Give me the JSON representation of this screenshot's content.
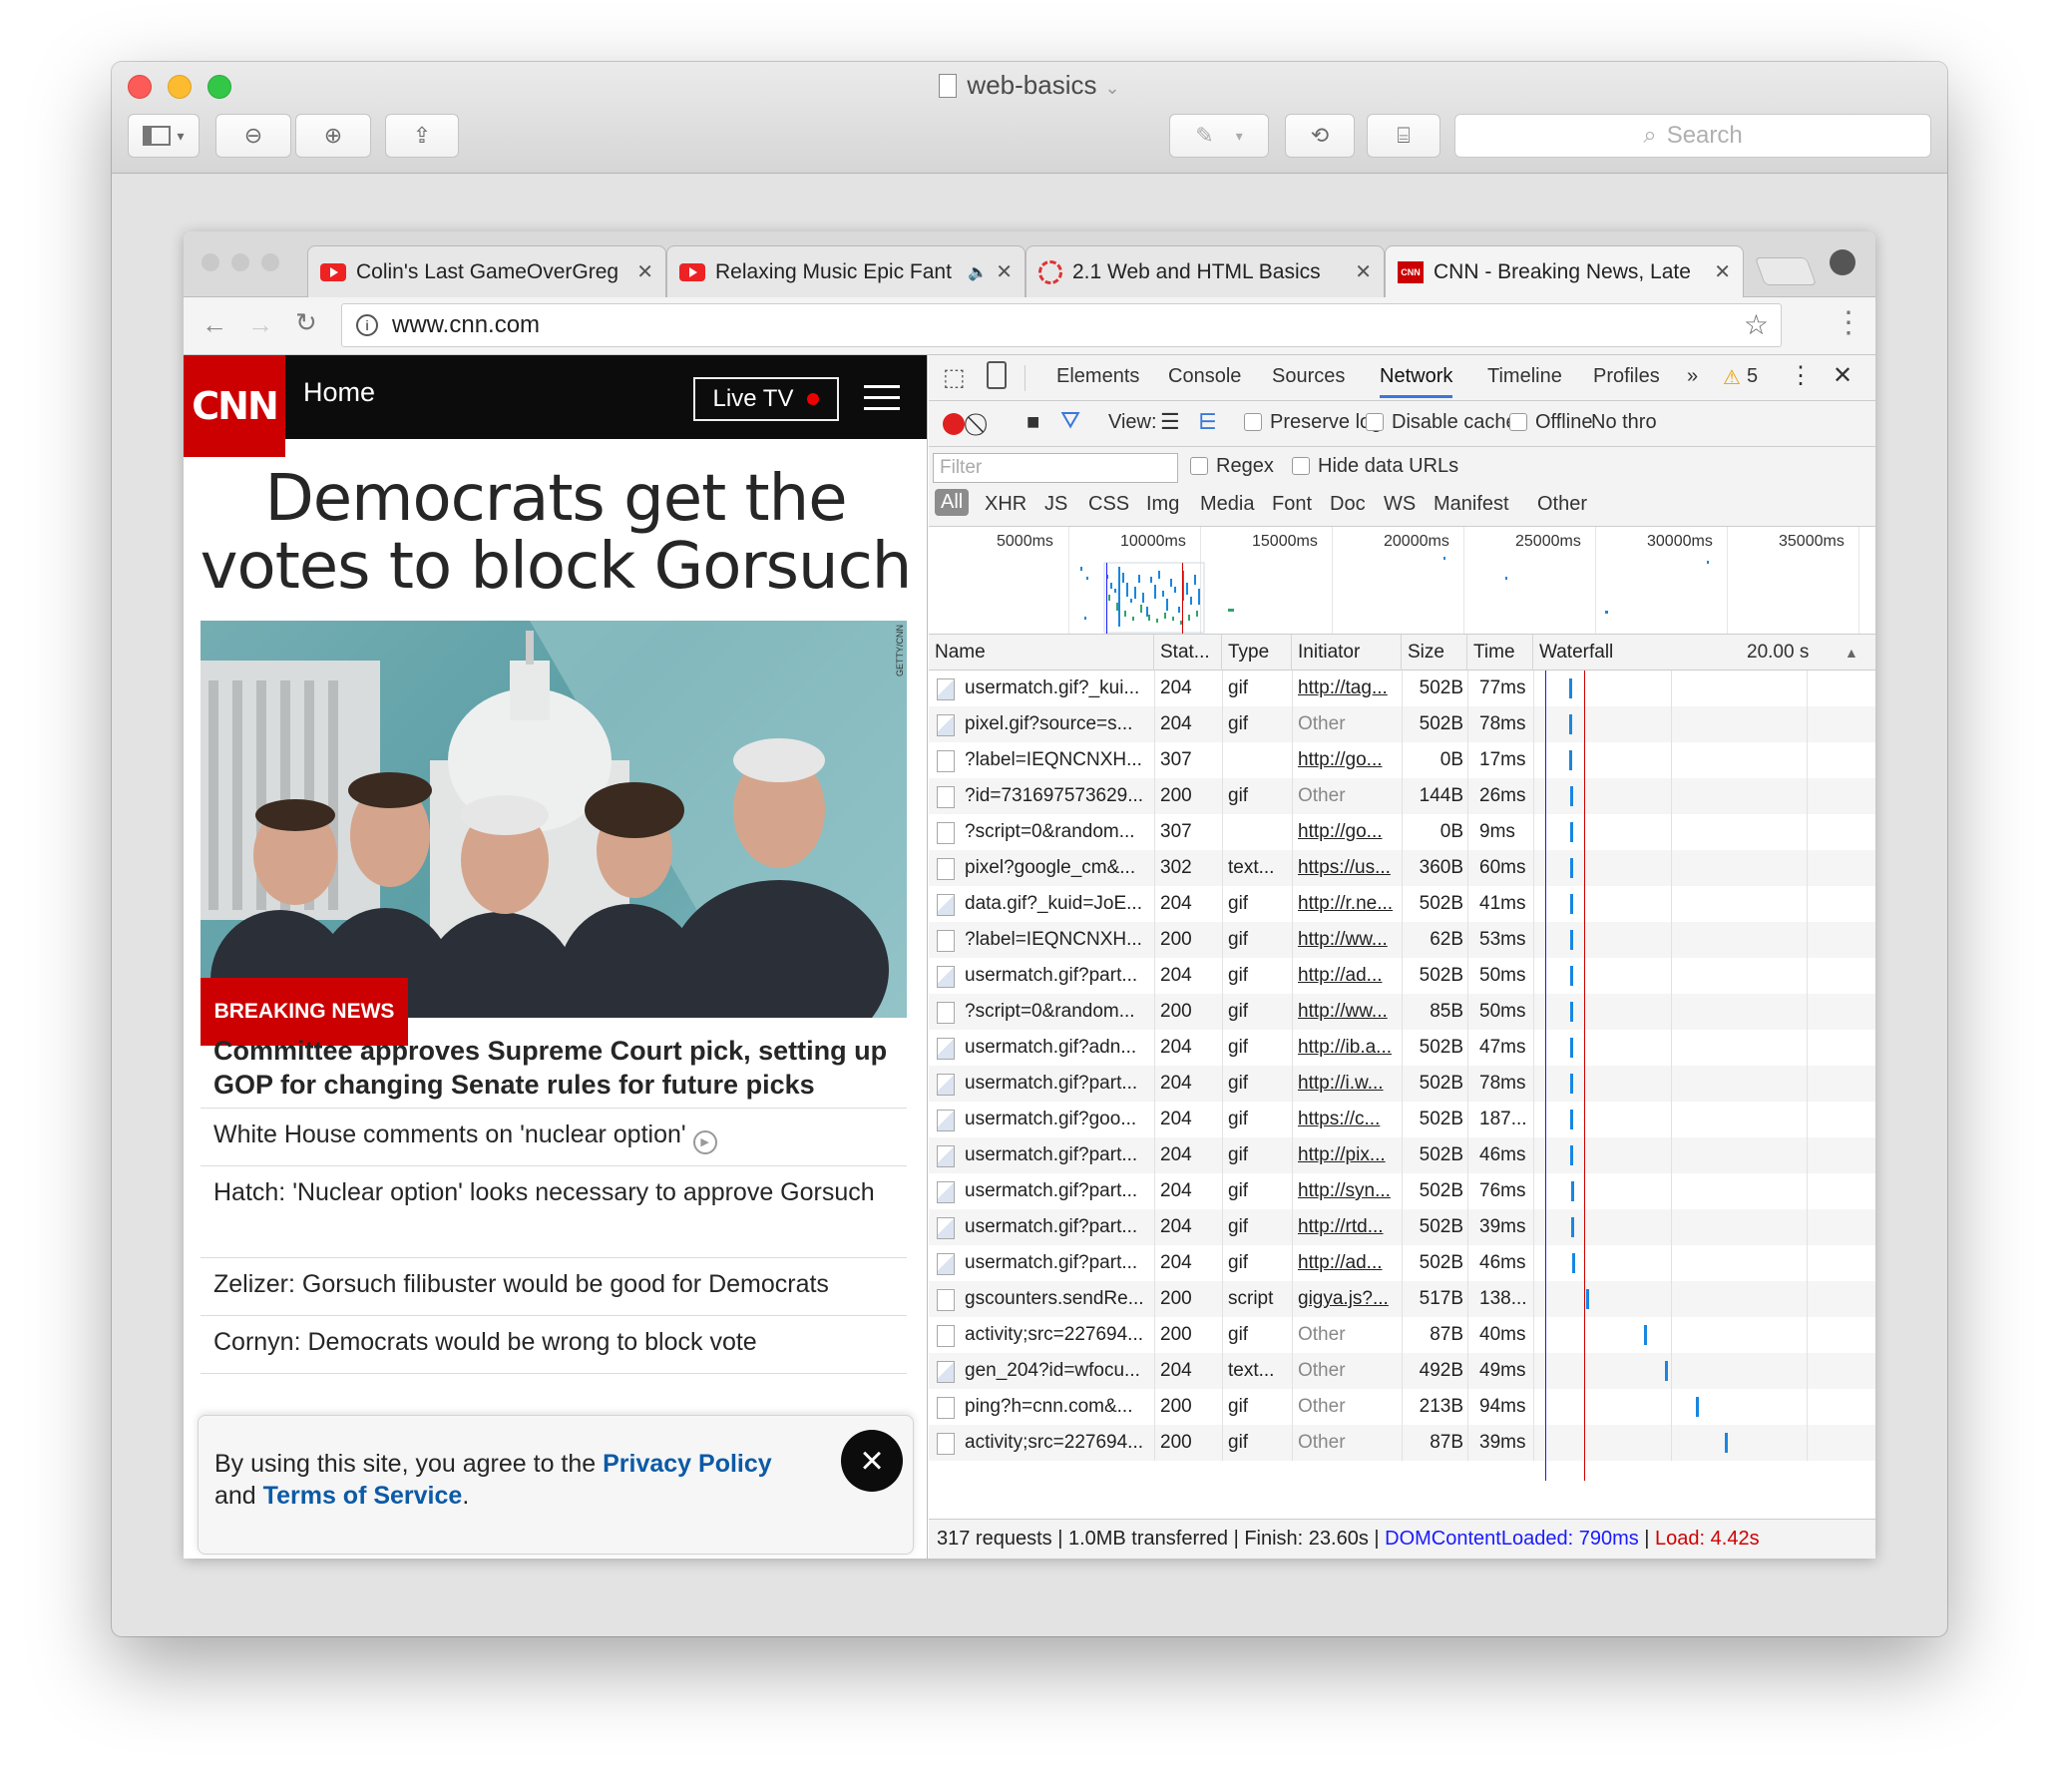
{
  "preview": {
    "title": "web-basics",
    "search_placeholder": "Search"
  },
  "chrome": {
    "tabs": [
      {
        "label": "Colin's Last GameOverGreg",
        "icon": "youtube-icon"
      },
      {
        "label": "Relaxing Music Epic Fant",
        "icon": "youtube-icon",
        "audio": true
      },
      {
        "label": "2.1 Web and HTML Basics",
        "icon": "gear-badge-icon"
      },
      {
        "label": "CNN - Breaking News, Late",
        "icon": "cnn-icon"
      }
    ],
    "url": "www.cnn.com"
  },
  "cnn": {
    "logo": "CNN",
    "home_label": "Home",
    "livetv_label": "Live TV",
    "headline": "Democrats get the votes to block Gorsuch",
    "photo_credit": "GETTY/CNN",
    "breaking_label": "BREAKING NEWS",
    "story_headline": "Committee approves Supreme Court pick, setting up GOP for changing Senate rules for future picks",
    "links": [
      "White House comments on 'nuclear option'",
      "Hatch: 'Nuclear option' looks necessary to approve Gorsuch",
      "Zelizer: Gorsuch filibuster would be good for Democrats",
      "Cornyn: Democrats would be wrong to block vote"
    ],
    "cookie": {
      "text_before": "By using this site, you agree to the ",
      "privacy": "Privacy Policy",
      "and": " and ",
      "terms": "Terms of Service",
      "period": "."
    }
  },
  "devtools": {
    "tabs": [
      "Elements",
      "Console",
      "Sources",
      "Network",
      "Timeline",
      "Profiles"
    ],
    "more_tabs": "»",
    "warnings": "5",
    "view_label": "View:",
    "preserve_log": "Preserve log",
    "disable_cache": "Disable cache",
    "offline": "Offline",
    "throttle": "No thro",
    "filter_placeholder": "Filter",
    "regex": "Regex",
    "hide_data_urls": "Hide data URLs",
    "types": [
      "All",
      "XHR",
      "JS",
      "CSS",
      "Img",
      "Media",
      "Font",
      "Doc",
      "WS",
      "Manifest",
      "Other"
    ],
    "overview_ticks": [
      "5000ms",
      "10000ms",
      "15000ms",
      "20000ms",
      "25000ms",
      "30000ms",
      "35000ms"
    ],
    "columns": {
      "name": "Name",
      "status": "Stat...",
      "type": "Type",
      "initiator": "Initiator",
      "size": "Size",
      "time": "Time",
      "waterfall": "Waterfall",
      "scale": "20.00 s"
    },
    "rows": [
      {
        "name": "usermatch.gif?_kui...",
        "status": "204",
        "type": "gif",
        "initiator": "http://tag...",
        "size": "502B",
        "time": "77ms",
        "icon": "img",
        "wf": 0.104
      },
      {
        "name": "pixel.gif?source=s...",
        "status": "204",
        "type": "gif",
        "initiator": "Other",
        "size": "502B",
        "time": "78ms",
        "icon": "img",
        "wf": 0.106
      },
      {
        "name": "?label=IEQNCNXH...",
        "status": "307",
        "type": "",
        "initiator": "http://go...",
        "size": "0B",
        "time": "17ms",
        "icon": "doc",
        "wf": 0.106
      },
      {
        "name": "?id=731697573629...",
        "status": "200",
        "type": "gif",
        "initiator": "Other",
        "size": "144B",
        "time": "26ms",
        "icon": "doc",
        "wf": 0.108
      },
      {
        "name": "?script=0&random...",
        "status": "307",
        "type": "",
        "initiator": "http://go...",
        "size": "0B",
        "time": "9ms",
        "icon": "doc",
        "wf": 0.108
      },
      {
        "name": "pixel?google_cm&...",
        "status": "302",
        "type": "text...",
        "initiator": "https://us...",
        "size": "360B",
        "time": "60ms",
        "icon": "doc",
        "wf": 0.108
      },
      {
        "name": "data.gif?_kuid=JoE...",
        "status": "204",
        "type": "gif",
        "initiator": "http://r.ne...",
        "size": "502B",
        "time": "41ms",
        "icon": "img",
        "wf": 0.108
      },
      {
        "name": "?label=IEQNCNXH...",
        "status": "200",
        "type": "gif",
        "initiator": "http://ww...",
        "size": "62B",
        "time": "53ms",
        "icon": "doc",
        "wf": 0.108
      },
      {
        "name": "usermatch.gif?part...",
        "status": "204",
        "type": "gif",
        "initiator": "http://ad...",
        "size": "502B",
        "time": "50ms",
        "icon": "img",
        "wf": 0.108
      },
      {
        "name": "?script=0&random...",
        "status": "200",
        "type": "gif",
        "initiator": "http://ww...",
        "size": "85B",
        "time": "50ms",
        "icon": "doc",
        "wf": 0.108
      },
      {
        "name": "usermatch.gif?adn...",
        "status": "204",
        "type": "gif",
        "initiator": "http://ib.a...",
        "size": "502B",
        "time": "47ms",
        "icon": "img",
        "wf": 0.108
      },
      {
        "name": "usermatch.gif?part...",
        "status": "204",
        "type": "gif",
        "initiator": "http://i.w...",
        "size": "502B",
        "time": "78ms",
        "icon": "img",
        "wf": 0.108
      },
      {
        "name": "usermatch.gif?goo...",
        "status": "204",
        "type": "gif",
        "initiator": "https://c...",
        "size": "502B",
        "time": "187...",
        "icon": "img",
        "wf": 0.108
      },
      {
        "name": "usermatch.gif?part...",
        "status": "204",
        "type": "gif",
        "initiator": "http://pix...",
        "size": "502B",
        "time": "46ms",
        "icon": "img",
        "wf": 0.108
      },
      {
        "name": "usermatch.gif?part...",
        "status": "204",
        "type": "gif",
        "initiator": "http://syn...",
        "size": "502B",
        "time": "76ms",
        "icon": "img",
        "wf": 0.11
      },
      {
        "name": "usermatch.gif?part...",
        "status": "204",
        "type": "gif",
        "initiator": "http://rtd...",
        "size": "502B",
        "time": "39ms",
        "icon": "img",
        "wf": 0.112
      },
      {
        "name": "usermatch.gif?part...",
        "status": "204",
        "type": "gif",
        "initiator": "http://ad...",
        "size": "502B",
        "time": "46ms",
        "icon": "img",
        "wf": 0.114
      },
      {
        "name": "gscounters.sendRe...",
        "status": "200",
        "type": "script",
        "initiator": "gigya.js?...",
        "size": "517B",
        "time": "138...",
        "icon": "script",
        "wf": 0.155
      },
      {
        "name": "activity;src=227694...",
        "status": "200",
        "type": "gif",
        "initiator": "Other",
        "size": "87B",
        "time": "40ms",
        "icon": "doc",
        "wf": 0.325
      },
      {
        "name": "gen_204?id=wfocu...",
        "status": "204",
        "type": "text...",
        "initiator": "Other",
        "size": "492B",
        "time": "49ms",
        "icon": "img",
        "wf": 0.385
      },
      {
        "name": "ping?h=cnn.com&...",
        "status": "200",
        "type": "gif",
        "initiator": "Other",
        "size": "213B",
        "time": "94ms",
        "icon": "doc",
        "wf": 0.475
      },
      {
        "name": "activity;src=227694...",
        "status": "200",
        "type": "gif",
        "initiator": "Other",
        "size": "87B",
        "time": "39ms",
        "icon": "doc",
        "wf": 0.56
      }
    ],
    "status_bar": {
      "summary": "317 requests | 1.0MB transferred | Finish: 23.60s | ",
      "dcl": "DOMContentLoaded: 790ms",
      "sep": " | ",
      "load": "Load: 4.42s"
    },
    "colors": {
      "dcl": "#1a1aff",
      "load": "#d00000",
      "accent": "#3879d9"
    }
  }
}
